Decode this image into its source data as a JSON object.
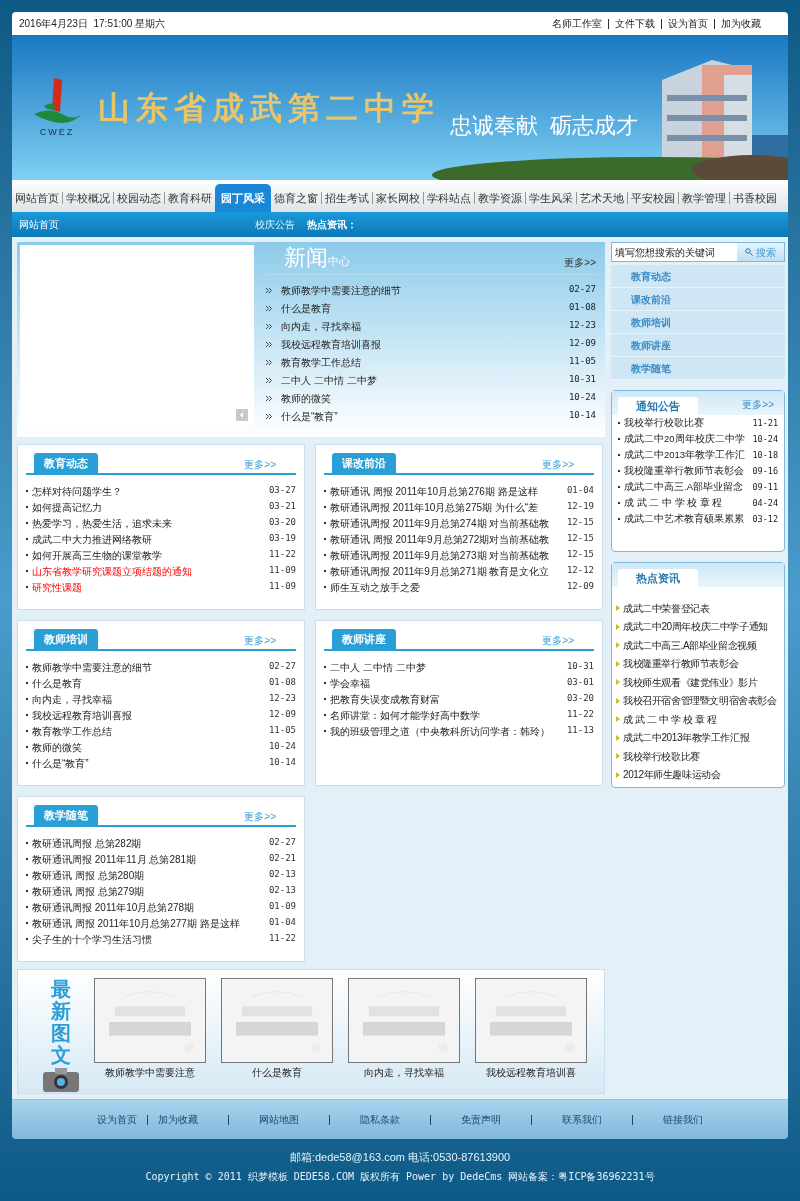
{
  "top_bar": {
    "datetime": "2016年4月23日  17:51:00 星期六",
    "links": [
      "名师工作室",
      "文件下载",
      "设为首页",
      "加为收藏"
    ]
  },
  "banner": {
    "logo_text": "CWEZ",
    "school_name": "山东省成武第二中学",
    "slogan": "忠诚奉献  砺志成才"
  },
  "nav": [
    {
      "label": "网站首页",
      "selected": false
    },
    {
      "label": "学校概况",
      "selected": false
    },
    {
      "label": "校园动态",
      "selected": false
    },
    {
      "label": "教育科研",
      "selected": false
    },
    {
      "label": "园丁风采",
      "selected": true
    },
    {
      "label": "德育之窗",
      "selected": false
    },
    {
      "label": "招生考试",
      "selected": false
    },
    {
      "label": "家长网校",
      "selected": false
    },
    {
      "label": "学科站点",
      "selected": false
    },
    {
      "label": "教学资源",
      "selected": false
    },
    {
      "label": "学生风采",
      "selected": false
    },
    {
      "label": "艺术天地",
      "selected": false
    },
    {
      "label": "平安校园",
      "selected": false
    },
    {
      "label": "教学管理",
      "selected": false
    },
    {
      "label": "书香校园",
      "selected": false
    }
  ],
  "sub_bar": {
    "home": "网站首页",
    "notice_label": "校庆公告",
    "hot_label": "热点资讯："
  },
  "news_center": {
    "title_big": "新闻",
    "title_small": "中心",
    "more": "更多>>",
    "items": [
      {
        "title": "教师教学中需要注意的细节",
        "date": "02-27"
      },
      {
        "title": "什么是教育",
        "date": "01-08"
      },
      {
        "title": "向内走，寻找幸福",
        "date": "12-23"
      },
      {
        "title": "我校远程教育培训喜报",
        "date": "12-09"
      },
      {
        "title": "教育教学工作总结",
        "date": "11-05"
      },
      {
        "title": "二中人 二中情 二中梦",
        "date": "10-31"
      },
      {
        "title": "教师的微笑",
        "date": "10-24"
      },
      {
        "title": "什么是“教育”",
        "date": "10-14"
      }
    ]
  },
  "search": {
    "placeholder": "填写您想搜索的关键词",
    "button": "搜索"
  },
  "side_menu": [
    "教育动态",
    "课改前沿",
    "教师培训",
    "教师讲座",
    "教学随笔"
  ],
  "notices": {
    "title": "通知公告",
    "more": "更多>>",
    "items": [
      {
        "title": "我校举行校歌比赛",
        "date": "11-21"
      },
      {
        "title": "成武二中20周年校庆二中学",
        "date": "10-24"
      },
      {
        "title": "成武二中2013年教学工作汇",
        "date": "10-18"
      },
      {
        "title": "我校隆重举行教师节表彰会",
        "date": "09-16"
      },
      {
        "title": "成武二中高三.A部毕业留念",
        "date": "09-11"
      },
      {
        "title": "成 武 二 中 学 校 章 程",
        "date": "04-24"
      },
      {
        "title": "成武二中艺术教育硕果累累",
        "date": "03-12"
      }
    ]
  },
  "hot_news": {
    "title": "热点资讯",
    "items": [
      "成武二中荣誉登记表",
      "成武二中20周年校庆二中学子通知",
      "成武二中高三.A部毕业留念视频",
      "我校隆重举行教师节表彰会",
      "我校师生观看《建党伟业》影片",
      "我校召开宿舍管理暨文明宿舍表彰会",
      "成 武 二 中 学 校 章 程",
      "成武二中2013年教学工作汇报",
      "我校举行校歌比赛",
      "2012年师生趣味运动会"
    ]
  },
  "sections": [
    {
      "title": "教育动态",
      "more": "更多>>",
      "items": [
        {
          "title": "怎样对待问题学生？",
          "date": "03-27",
          "highlighted": false
        },
        {
          "title": "如何提高记忆力",
          "date": "03-21",
          "highlighted": false
        },
        {
          "title": "热爱学习，热爱生活，追求未来",
          "date": "03-20",
          "highlighted": false
        },
        {
          "title": "成武二中大力推进网络教研",
          "date": "03-19",
          "highlighted": false
        },
        {
          "title": "如何开展高三生物的课堂教学",
          "date": "11-22",
          "highlighted": false
        },
        {
          "title": "山东省教学研究课题立项结题的通知",
          "date": "11-09",
          "highlighted": true
        },
        {
          "title": "研究性课题",
          "date": "11-09",
          "highlighted": true
        }
      ]
    },
    {
      "title": "课改前沿",
      "more": "更多>>",
      "items": [
        {
          "title": "教研通讯  周报 2011年10月总第276期 路是这样",
          "date": "01-04"
        },
        {
          "title": "教研通讯周报 2011年10月总第275期 为什么“差",
          "date": "12-19"
        },
        {
          "title": "教研通讯周报 2011年9月总第274期 对当前基础教",
          "date": "12-15"
        },
        {
          "title": "教研通讯  周报 2011年9月总第272期对当前基础教",
          "date": "12-15"
        },
        {
          "title": "教研通讯周报 2011年9月总第273期 对当前基础教",
          "date": "12-15"
        },
        {
          "title": "教研通讯周报 2011年9月总第271期 教育是文化立",
          "date": "12-12"
        },
        {
          "title": "师生互动之放手之爱",
          "date": "12-09"
        }
      ]
    },
    {
      "title": "教师培训",
      "more": "更多>>",
      "items": [
        {
          "title": "教师教学中需要注意的细节",
          "date": "02-27"
        },
        {
          "title": "什么是教育",
          "date": "01-08"
        },
        {
          "title": "向内走，寻找幸福",
          "date": "12-23"
        },
        {
          "title": "我校远程教育培训喜报",
          "date": "12-09"
        },
        {
          "title": "教育教学工作总结",
          "date": "11-05"
        },
        {
          "title": "教师的微笑",
          "date": "10-24"
        },
        {
          "title": "什么是“教育”",
          "date": "10-14"
        }
      ]
    },
    {
      "title": "教师讲座",
      "more": "更多>>",
      "items": [
        {
          "title": "二中人 二中情 二中梦",
          "date": "10-31"
        },
        {
          "title": "学会幸福",
          "date": "03-01"
        },
        {
          "title": "把教育失误变成教育财富",
          "date": "03-20"
        },
        {
          "title": "名师讲堂：如何才能学好高中数学",
          "date": "11-22"
        },
        {
          "title": "我的班级管理之道（中央教科所访问学者：韩玲）",
          "date": "11-13"
        }
      ]
    },
    {
      "title": "教学随笔",
      "more": "更多>>",
      "items": [
        {
          "title": "教研通讯周报 总第282期",
          "date": "02-27"
        },
        {
          "title": "教研通讯周报 2011年11月 总第281期",
          "date": "02-21"
        },
        {
          "title": "教研通讯 周报 总第280期",
          "date": "02-13"
        },
        {
          "title": "教研通讯 周报 总第279期",
          "date": "02-13"
        },
        {
          "title": "教研通讯周报 2011年10月总第278期",
          "date": "01-09"
        },
        {
          "title": "教研通讯 周报 2011年10月总第277期 路是这样",
          "date": "01-04"
        },
        {
          "title": "尖子生的十个学习生活习惯",
          "date": "11-22"
        }
      ]
    }
  ],
  "latest_pictures": {
    "title": "最新图文",
    "items": [
      {
        "caption": "教师教学中需要注意",
        "kind": "picture"
      },
      {
        "caption": "什么是教育",
        "kind": "picture"
      },
      {
        "caption": "向内走，寻找幸福",
        "kind": "picture"
      },
      {
        "caption": "我校远程教育培训喜",
        "kind": "picture"
      }
    ]
  },
  "footer_links": [
    "设为首页",
    "加为收藏",
    "网站地图",
    "隐私条款",
    "免责声明",
    "联系我们",
    "链接我们"
  ],
  "contact": "邮箱:dede58@163.com 电话:0530-87613900",
  "copyright": "Copyright © 2011 织梦模板 DEDE58.COM 版权所有 Power by DedeCms 网站备案：粤ICP备36962231号"
}
